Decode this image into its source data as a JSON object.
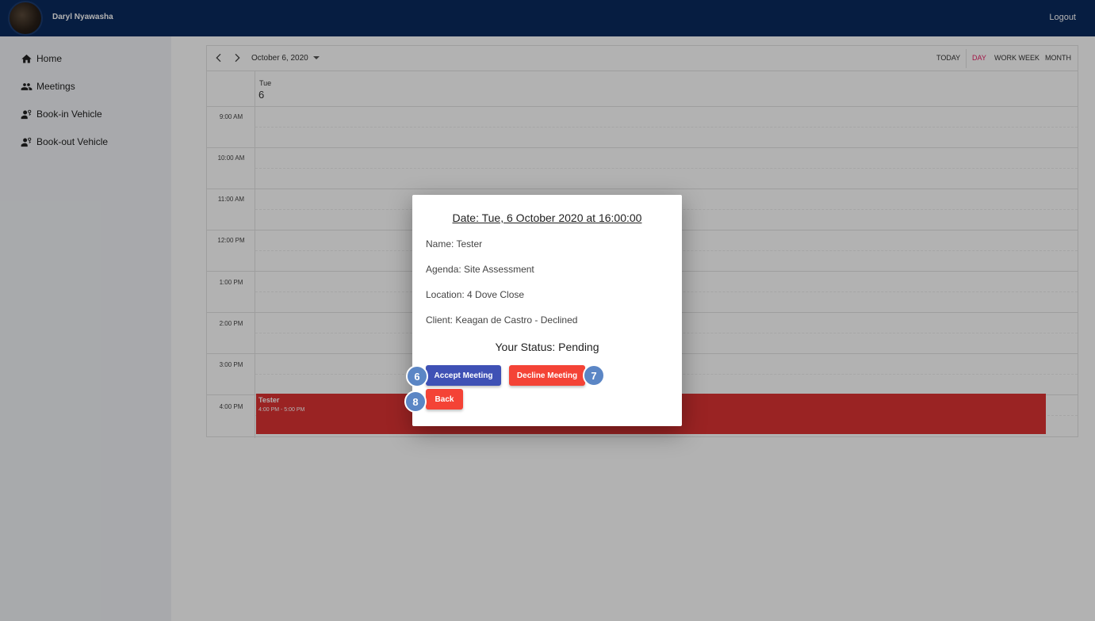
{
  "header": {
    "username": "Daryl Nyawasha",
    "logout_label": "Logout"
  },
  "sidebar": {
    "items": [
      {
        "label": "Home",
        "icon": "home-icon"
      },
      {
        "label": "Meetings",
        "icon": "people-icon"
      },
      {
        "label": "Book-in Vehicle",
        "icon": "person-key-icon"
      },
      {
        "label": "Book-out Vehicle",
        "icon": "person-key-icon"
      }
    ]
  },
  "calendar": {
    "current_date": "October 6, 2020",
    "views": [
      "TODAY",
      "DAY",
      "WORK WEEK",
      "MONTH"
    ],
    "active_view": "DAY",
    "accent_color": "#e91e63",
    "day_name": "Tue",
    "day_number": "6",
    "time_slots": [
      "9:00 AM",
      "10:00 AM",
      "11:00 AM",
      "12:00 PM",
      "1:00 PM",
      "2:00 PM",
      "3:00 PM",
      "4:00 PM"
    ],
    "event": {
      "title": "Tester",
      "time": "4:00 PM - 5:00 PM",
      "color": "#d33333"
    }
  },
  "modal": {
    "title": "Date: Tue, 6 October 2020 at 16:00:00",
    "name": "Name: Tester",
    "agenda": "Agenda: Site Assessment",
    "location": "Location: 4 Dove Close",
    "client": "Client: Keagan de Castro - Declined",
    "status": "Your Status: Pending",
    "accept_label": "Accept Meeting",
    "decline_label": "Decline Meeting",
    "back_label": "Back"
  },
  "markers": [
    "6",
    "7",
    "8"
  ]
}
